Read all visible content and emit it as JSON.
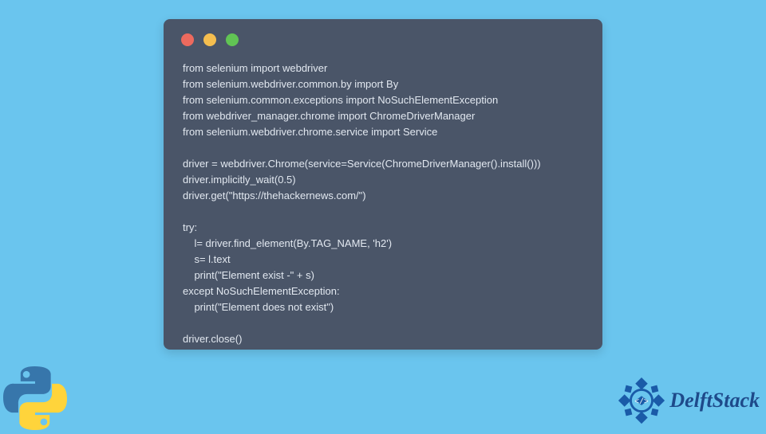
{
  "code": {
    "lines": [
      "from selenium import webdriver",
      "from selenium.webdriver.common.by import By",
      "from selenium.common.exceptions import NoSuchElementException",
      "from webdriver_manager.chrome import ChromeDriverManager",
      "from selenium.webdriver.chrome.service import Service",
      "",
      "driver = webdriver.Chrome(service=Service(ChromeDriverManager().install()))",
      "driver.implicitly_wait(0.5)",
      "driver.get(\"https://thehackernews.com/\")",
      "",
      "try:",
      "    l= driver.find_element(By.TAG_NAME, 'h2')",
      "    s= l.text",
      "    print(\"Element exist -\" + s)",
      "except NoSuchElementException:",
      "    print(\"Element does not exist\")",
      "",
      "driver.close()"
    ]
  },
  "branding": {
    "delftstack": "DelftStack"
  }
}
